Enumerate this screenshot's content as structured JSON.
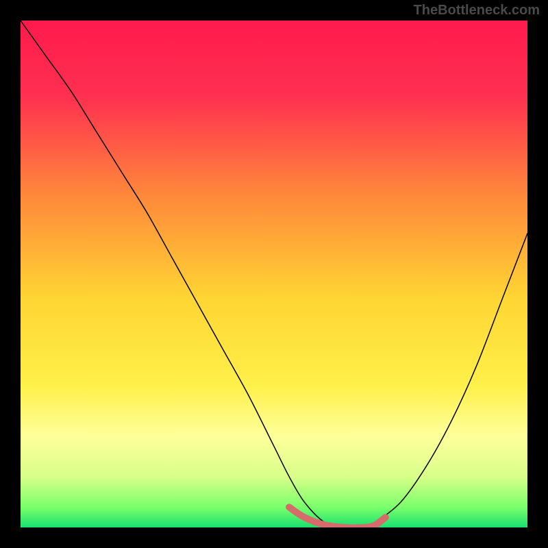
{
  "watermark": "TheBottleneck.com",
  "chart_data": {
    "type": "line",
    "title": "",
    "xlabel": "",
    "ylabel": "",
    "xlim": [
      0,
      100
    ],
    "ylim": [
      0,
      100
    ],
    "background_gradient": {
      "description": "vertical gradient red-pink at top through orange, yellow, pale-yellow to green at bottom",
      "stops": [
        {
          "pos": 0.0,
          "color": "#ff1a4d"
        },
        {
          "pos": 0.15,
          "color": "#ff3050"
        },
        {
          "pos": 0.35,
          "color": "#ff8a3a"
        },
        {
          "pos": 0.55,
          "color": "#ffd633"
        },
        {
          "pos": 0.72,
          "color": "#fff04a"
        },
        {
          "pos": 0.82,
          "color": "#feff9a"
        },
        {
          "pos": 0.9,
          "color": "#d8ff8a"
        },
        {
          "pos": 0.96,
          "color": "#7aff6a"
        },
        {
          "pos": 1.0,
          "color": "#19e070"
        }
      ]
    },
    "series": [
      {
        "name": "main-curve",
        "color": "#000000",
        "stroke_width": 1.5,
        "x": [
          0,
          5,
          10,
          15,
          20,
          25,
          30,
          35,
          40,
          45,
          50,
          53,
          56,
          60,
          64,
          68,
          70,
          75,
          80,
          85,
          90,
          95,
          100
        ],
        "y": [
          100,
          93,
          86,
          78,
          70,
          62,
          53,
          44,
          35,
          26,
          16,
          10,
          5,
          1,
          0,
          0,
          1,
          5,
          12,
          21,
          32,
          45,
          58
        ]
      },
      {
        "name": "highlight-segment",
        "color": "#d76a6a",
        "stroke_width": 10,
        "linecap": "round",
        "x": [
          53,
          56,
          60,
          64,
          68,
          70,
          72
        ],
        "y": [
          4,
          2,
          0.5,
          0,
          0,
          0.5,
          2
        ]
      }
    ],
    "annotations": []
  }
}
